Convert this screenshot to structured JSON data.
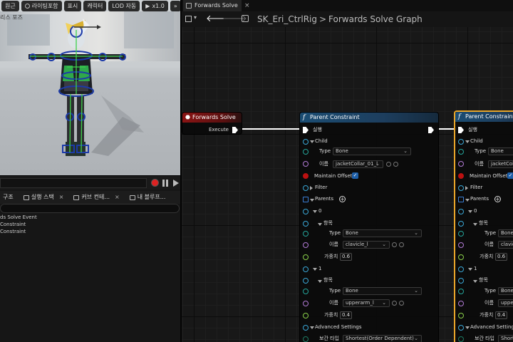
{
  "viewport": {
    "toolbar": {
      "btn1": "원근",
      "btn2": "라이팅포함",
      "btn3": "표시",
      "btn4": "캐릭터",
      "btn5": "LOD 자동",
      "btn6": "x1.0",
      "btn7": "»"
    },
    "pose_label": "리스 포즈"
  },
  "bottom_panel": {
    "tabs": [
      {
        "label": "구조"
      },
      {
        "label": "실행 스택",
        "close": "×"
      },
      {
        "label": "커브 컨테...",
        "close": "×"
      },
      {
        "label": "내 블루프..."
      }
    ],
    "outline": [
      "ds Solve Event",
      "Constraint",
      "Constraint"
    ]
  },
  "graph": {
    "tab_title": "Forwards Solve",
    "tab_close": "×",
    "nav": {
      "back": "🡐",
      "fwd": "🡒",
      "caret": "▾"
    },
    "breadcrumb": {
      "asset": "SK_Eri_CtrlRig",
      "sep": ">",
      "graph": "Forwards Solve Graph"
    },
    "event_node": {
      "title": "Forwards Solve",
      "execute": "Execute"
    },
    "node1": {
      "title": "Parent Constraint",
      "exec": "실행",
      "child": "Child",
      "type_label": "Type",
      "type_value": "Bone",
      "name_label": "이름",
      "name_value": "jacketCollar_01_l",
      "maintain_offset": "Maintain Offset",
      "filter": "Filter",
      "parents": "Parents",
      "idx0": "0",
      "item": "항목",
      "type_value_0": "Bone",
      "name_value_0": "clavicle_l",
      "weight_label": "가중치",
      "weight_0": "0.6",
      "idx1": "1",
      "type_value_1": "Bone",
      "name_value_1": "upperarm_l",
      "weight_1": "0.4",
      "advanced": "Advanced Settings",
      "interp_label": "보간 타입",
      "interp_value": "Shortest(Order Dependent)"
    },
    "node2": {
      "title": "Parent Constraint",
      "exec": "실행",
      "child": "Child",
      "type_label": "Type",
      "type_value": "Bone",
      "name_label": "이름",
      "name_value": "jacketColla",
      "maintain_offset": "Maintain Offset",
      "filter": "Filter",
      "parents": "Parents",
      "idx0": "0",
      "item": "항목",
      "type_value_0": "Bone",
      "name_value_0": "clavic",
      "weight_label": "가중치",
      "weight_0": "0.6",
      "idx1": "1",
      "type_value_1": "Bone",
      "name_value_1": "uppera",
      "weight_1": "0.4",
      "advanced": "Advanced Settings",
      "interp_label": "보간 타입",
      "interp_value": "Shorte"
    }
  },
  "colors": {
    "event_header": "#8a1414",
    "function_header": "#1b4d73",
    "selected_outline": "#e9a62a",
    "bone_green": "#3fd14a",
    "control_blue": "#1c3aa8"
  }
}
